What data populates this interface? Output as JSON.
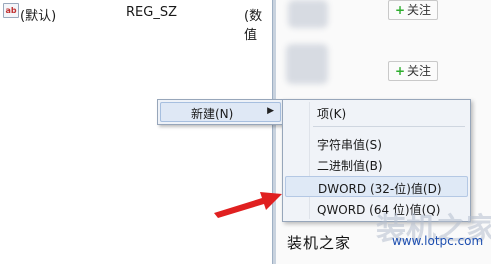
{
  "registry_row": {
    "icon": "ab-string-icon",
    "icon_text": "ab",
    "name": "(默认)",
    "type": "REG_SZ",
    "data": "(数值"
  },
  "right_panel": {
    "follow_buttons": [
      "关注",
      "关注"
    ]
  },
  "context_menu": {
    "new_label": "新建(N)",
    "arrow": "▶"
  },
  "submenu": {
    "items": [
      {
        "label": "项(K)"
      },
      {
        "label": "字符串值(S)"
      },
      {
        "label": "二进制值(B)"
      },
      {
        "label": "DWORD (32-位)值(D)"
      },
      {
        "label": "QWORD (64 位)值(Q)"
      }
    ]
  },
  "watermark": {
    "text": "装机之家",
    "url": "www.lotpc.com",
    "faint": "装机之家"
  },
  "colors": {
    "arrow": "#e02020",
    "plus": "#2eae2e"
  }
}
